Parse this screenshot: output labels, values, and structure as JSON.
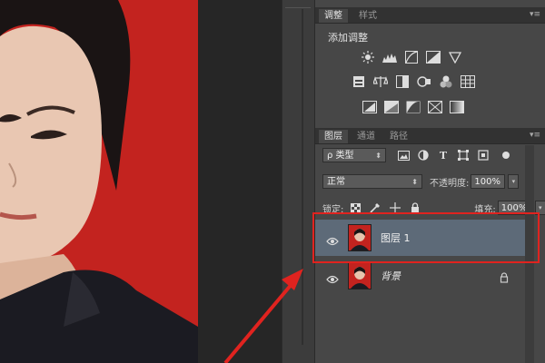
{
  "adjustments_panel": {
    "tabs": [
      "调整",
      "样式"
    ],
    "menu_icon": "panel-menu-icon",
    "title": "添加调整",
    "row1_icons": [
      "brightness-icon",
      "levels-icon",
      "curves-icon",
      "exposure-icon",
      "vibrance-icon"
    ],
    "row2_icons": [
      "hue-saturation-icon",
      "color-balance-icon",
      "black-white-icon",
      "photo-filter-icon",
      "channel-mixer-icon",
      "color-lookup-icon"
    ],
    "row3_icons": [
      "invert-icon",
      "posterize-icon",
      "threshold-icon",
      "selective-color-icon",
      "gradient-map-icon"
    ]
  },
  "layers_panel": {
    "tabs": [
      "图层",
      "通道",
      "路径"
    ],
    "filter_label": "ρ 类型",
    "blend_mode": "正常",
    "opacity_label": "不透明度:",
    "opacity_value": "100%",
    "lock_label": "锁定:",
    "fill_label": "填充:",
    "fill_value": "100%",
    "layers": [
      {
        "name": "图层 1",
        "selected": true,
        "visible": true,
        "locked": false
      },
      {
        "name": "背景",
        "selected": false,
        "visible": true,
        "locked": true
      }
    ]
  },
  "colors": {
    "photo_background": "#c3231f",
    "selection_highlight": "#5d6a78",
    "annotation_red": "#e0231f"
  }
}
